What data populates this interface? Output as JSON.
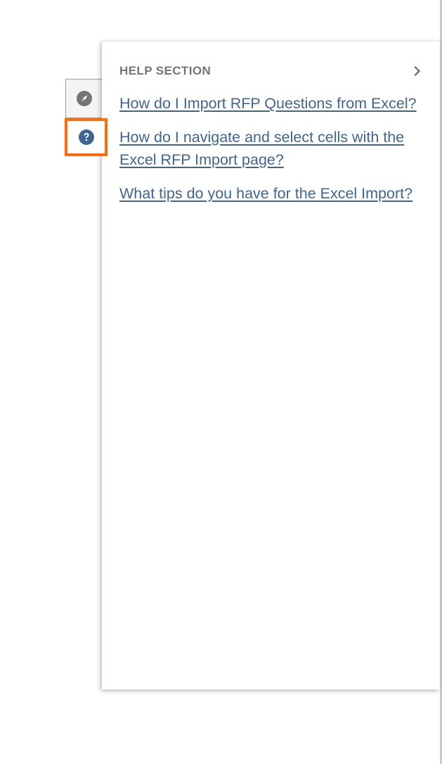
{
  "help_panel": {
    "title": "HELP SECTION",
    "links": [
      "How do I Import RFP Questions from Excel?",
      "How do I navigate and select cells with the Excel RFP Import page?",
      "What tips do you have for the Excel Import?"
    ]
  },
  "side_tabs": {
    "icons": [
      "compass-icon",
      "question-circle-icon"
    ]
  },
  "colors": {
    "link": "#3e6593",
    "title": "#757575",
    "highlight": "#ff6b0a",
    "help_icon": "#3e6593",
    "compass_icon": "#757575"
  }
}
